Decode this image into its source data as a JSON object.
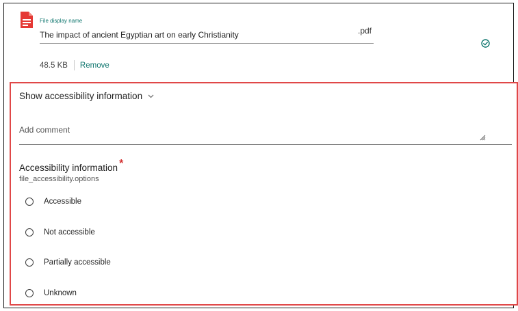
{
  "file": {
    "display_name_label": "File display name",
    "name": "The impact of ancient Egyptian art on early Christianity",
    "extension": ".pdf",
    "size": "48.5 KB",
    "remove_label": "Remove",
    "status_icon": "check-circle-icon",
    "type_icon": "pdf-file-icon"
  },
  "accessibility": {
    "toggle_label": "Show accessibility information",
    "comment_placeholder": "Add comment",
    "group_label": "Accessibility information",
    "required_marker": "*",
    "group_description": "file_accessibility.options",
    "options": [
      {
        "label": "Accessible",
        "selected": false
      },
      {
        "label": "Not accessible",
        "selected": false
      },
      {
        "label": "Partially accessible",
        "selected": false
      },
      {
        "label": "Unknown",
        "selected": false
      }
    ]
  },
  "colors": {
    "accent": "#0f766e",
    "file_icon_red": "#e53935",
    "highlight_border": "#e04848",
    "required": "#d32f2f"
  }
}
